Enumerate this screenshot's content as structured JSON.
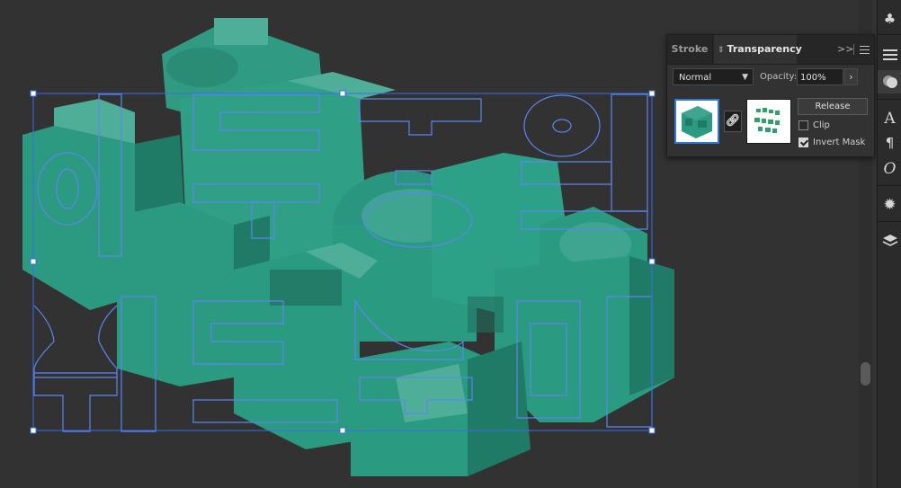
{
  "colors": {
    "canvas": "#323232",
    "letter_top": "#3c9e8a",
    "letter_front": "#2a9a80",
    "letter_side": "#1f7a66",
    "outline": "#5b86f0",
    "selection": "#3a6ee8"
  },
  "transparency_panel": {
    "tabs": [
      "Stroke",
      "Transparency"
    ],
    "overflow_icon": "double-chevron-right-icon",
    "menu_icon": "panel-menu-icon",
    "blend_mode": "Normal",
    "opacity_label": "Opacity:",
    "opacity_value": "100%",
    "release_label": "Release",
    "clip_label": "Clip",
    "clip_checked": false,
    "invert_mask_label": "Invert Mask",
    "invert_mask_checked": true,
    "link_icon": "chain-link-icon"
  },
  "artwork": {
    "line1": "이토록 이",
    "line2": "상하다"
  },
  "toolbar": {
    "icons": [
      "club-icon",
      "stroke-lines-icon",
      "transparency-circles-icon",
      "character-icon",
      "paragraph-icon",
      "opentype-icon",
      "sunburst-icon",
      "layers-icon"
    ]
  }
}
